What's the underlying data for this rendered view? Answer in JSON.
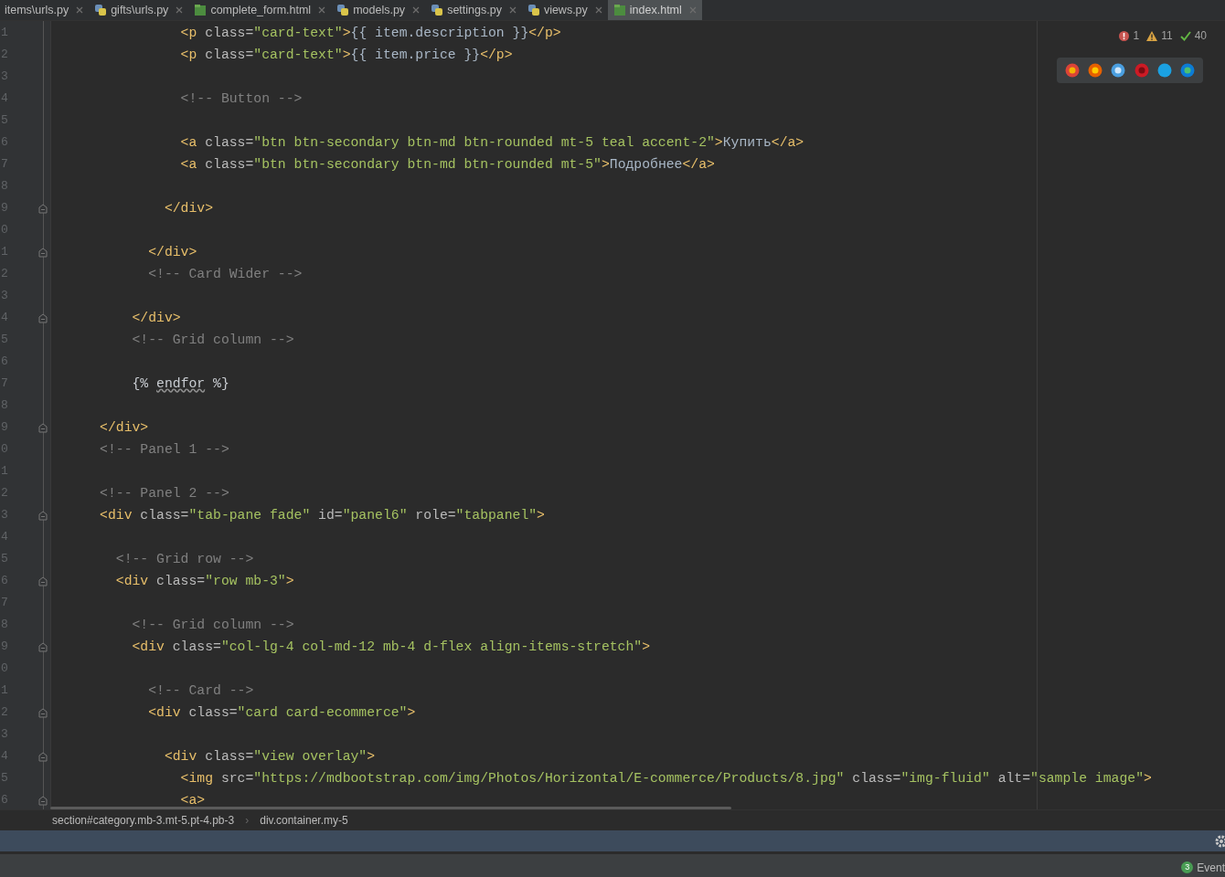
{
  "tabs": [
    {
      "label": "items\\urls.py",
      "kind": "py",
      "selected": false
    },
    {
      "label": "gifts\\urls.py",
      "kind": "py",
      "selected": false
    },
    {
      "label": "complete_form.html",
      "kind": "html",
      "selected": false
    },
    {
      "label": "models.py",
      "kind": "py",
      "selected": false
    },
    {
      "label": "settings.py",
      "kind": "py",
      "selected": false
    },
    {
      "label": "views.py",
      "kind": "py",
      "selected": false
    },
    {
      "label": "index.html",
      "kind": "html",
      "selected": true
    }
  ],
  "inspections": [
    {
      "kind": "error",
      "count": "1"
    },
    {
      "kind": "warning",
      "count": "11"
    },
    {
      "kind": "typo",
      "count": "40"
    }
  ],
  "lines": [
    {
      "number": "1",
      "fold": false,
      "tokens": [
        {
          "kind": "tag",
          "text": "                <p"
        },
        {
          "kind": "attr",
          "text": " class="
        },
        {
          "kind": "str",
          "text": "\"card-text\""
        },
        {
          "kind": "tag",
          "text": ">"
        },
        {
          "kind": "text",
          "text": "{{ item.description }}"
        },
        {
          "kind": "tag",
          "text": "</p>"
        }
      ]
    },
    {
      "number": "2",
      "fold": false,
      "tokens": [
        {
          "kind": "tag",
          "text": "                <p"
        },
        {
          "kind": "attr",
          "text": " class="
        },
        {
          "kind": "str",
          "text": "\"card-text\""
        },
        {
          "kind": "tag",
          "text": ">"
        },
        {
          "kind": "text",
          "text": "{{ item.price }}"
        },
        {
          "kind": "tag",
          "text": "</p>"
        }
      ]
    },
    {
      "number": "3",
      "fold": false
    },
    {
      "number": "4",
      "fold": false,
      "tokens": [
        {
          "kind": "comment",
          "text": "                <!-- Button -->"
        }
      ]
    },
    {
      "number": "5",
      "fold": false
    },
    {
      "number": "6",
      "fold": false,
      "tokens": [
        {
          "kind": "tag",
          "text": "                <a"
        },
        {
          "kind": "attr",
          "text": " class="
        },
        {
          "kind": "str",
          "text": "\"btn btn-secondary btn-md btn-rounded mt-5 teal accent-2\""
        },
        {
          "kind": "tag",
          "text": ">"
        },
        {
          "kind": "text",
          "text": "Купить"
        },
        {
          "kind": "tag",
          "text": "</a>"
        }
      ]
    },
    {
      "number": "7",
      "fold": false,
      "tokens": [
        {
          "kind": "tag",
          "text": "                <a"
        },
        {
          "kind": "attr",
          "text": " class="
        },
        {
          "kind": "str",
          "text": "\"btn btn-secondary btn-md btn-rounded mt-5\""
        },
        {
          "kind": "tag",
          "text": ">"
        },
        {
          "kind": "text",
          "text": "Подробнее"
        },
        {
          "kind": "tag",
          "text": "</a>"
        }
      ]
    },
    {
      "number": "8",
      "fold": false
    },
    {
      "number": "9",
      "fold": true,
      "tokens": [
        {
          "kind": "tag",
          "text": "              </div>"
        }
      ]
    },
    {
      "number": "0",
      "fold": false
    },
    {
      "number": "1",
      "fold": true,
      "tokens": [
        {
          "kind": "tag",
          "text": "            </div>"
        }
      ]
    },
    {
      "number": "2",
      "fold": false,
      "tokens": [
        {
          "kind": "comment",
          "text": "            <!-- Card Wider -->"
        }
      ]
    },
    {
      "number": "3",
      "fold": false
    },
    {
      "number": "4",
      "fold": true,
      "tokens": [
        {
          "kind": "tag",
          "text": "          </div>"
        }
      ]
    },
    {
      "number": "5",
      "fold": false,
      "tokens": [
        {
          "kind": "comment",
          "text": "          <!-- Grid column -->"
        }
      ]
    },
    {
      "number": "6",
      "fold": false
    },
    {
      "number": "7",
      "fold": false,
      "tokens": [
        {
          "kind": "tpl",
          "text": "          {% "
        },
        {
          "kind": "warn",
          "text": "endfor"
        },
        {
          "kind": "tpl",
          "text": " %}"
        }
      ]
    },
    {
      "number": "8",
      "fold": false
    },
    {
      "number": "9",
      "fold": true,
      "tokens": [
        {
          "kind": "tag",
          "text": "      </div>"
        }
      ]
    },
    {
      "number": "0",
      "fold": false,
      "tokens": [
        {
          "kind": "comment",
          "text": "      <!-- Panel 1 -->"
        }
      ]
    },
    {
      "number": "1",
      "fold": false
    },
    {
      "number": "2",
      "fold": false,
      "tokens": [
        {
          "kind": "comment",
          "text": "      <!-- Panel 2 -->"
        }
      ]
    },
    {
      "number": "3",
      "fold": true,
      "tokens": [
        {
          "kind": "tag",
          "text": "      <div"
        },
        {
          "kind": "attr",
          "text": " class="
        },
        {
          "kind": "str",
          "text": "\"tab-pane fade\""
        },
        {
          "kind": "attr",
          "text": " id="
        },
        {
          "kind": "str",
          "text": "\"panel6\""
        },
        {
          "kind": "attr",
          "text": " role="
        },
        {
          "kind": "str",
          "text": "\"tabpanel\""
        },
        {
          "kind": "tag",
          "text": ">"
        }
      ]
    },
    {
      "number": "4",
      "fold": false
    },
    {
      "number": "5",
      "fold": false,
      "tokens": [
        {
          "kind": "comment",
          "text": "        <!-- Grid row -->"
        }
      ]
    },
    {
      "number": "6",
      "fold": true,
      "tokens": [
        {
          "kind": "tag",
          "text": "        <div"
        },
        {
          "kind": "attr",
          "text": " class="
        },
        {
          "kind": "str",
          "text": "\"row mb-3\""
        },
        {
          "kind": "tag",
          "text": ">"
        }
      ]
    },
    {
      "number": "7",
      "fold": false
    },
    {
      "number": "8",
      "fold": false,
      "tokens": [
        {
          "kind": "comment",
          "text": "          <!-- Grid column -->"
        }
      ]
    },
    {
      "number": "9",
      "fold": true,
      "tokens": [
        {
          "kind": "tag",
          "text": "          <div"
        },
        {
          "kind": "attr",
          "text": " class="
        },
        {
          "kind": "str",
          "text": "\"col-lg-4 col-md-12 mb-4 d-flex align-items-stretch\""
        },
        {
          "kind": "tag",
          "text": ">"
        }
      ]
    },
    {
      "number": "0",
      "fold": false
    },
    {
      "number": "1",
      "fold": false,
      "tokens": [
        {
          "kind": "comment",
          "text": "            <!-- Card -->"
        }
      ]
    },
    {
      "number": "2",
      "fold": true,
      "tokens": [
        {
          "kind": "tag",
          "text": "            <div"
        },
        {
          "kind": "attr",
          "text": " class="
        },
        {
          "kind": "str",
          "text": "\"card card-ecommerce\""
        },
        {
          "kind": "tag",
          "text": ">"
        }
      ]
    },
    {
      "number": "3",
      "fold": false
    },
    {
      "number": "4",
      "fold": true,
      "tokens": [
        {
          "kind": "tag",
          "text": "              <div"
        },
        {
          "kind": "attr",
          "text": " class="
        },
        {
          "kind": "str",
          "text": "\"view overlay\""
        },
        {
          "kind": "tag",
          "text": ">"
        }
      ]
    },
    {
      "number": "5",
      "fold": false,
      "tokens": [
        {
          "kind": "tag",
          "text": "                <img"
        },
        {
          "kind": "attr",
          "text": " src="
        },
        {
          "kind": "str",
          "text": "\"https://mdbootstrap.com/img/Photos/Horizontal/E-commerce/Products/8.jpg\""
        },
        {
          "kind": "attr",
          "text": " class="
        },
        {
          "kind": "str",
          "text": "\"img-fluid\""
        },
        {
          "kind": "attr",
          "text": " alt="
        },
        {
          "kind": "str",
          "text": "\"sample image\""
        },
        {
          "kind": "tag",
          "text": ">"
        }
      ]
    },
    {
      "number": "6",
      "fold": true,
      "tokens": [
        {
          "kind": "tag",
          "text": "                <a>"
        }
      ]
    }
  ],
  "breadcrumbs": [
    {
      "label": "section#category.mb-3.mt-5.pt-4.pb-3"
    },
    {
      "separator": "›"
    },
    {
      "label": "div.container.my-5"
    }
  ],
  "status": {
    "badge": "3",
    "label": "Event"
  }
}
